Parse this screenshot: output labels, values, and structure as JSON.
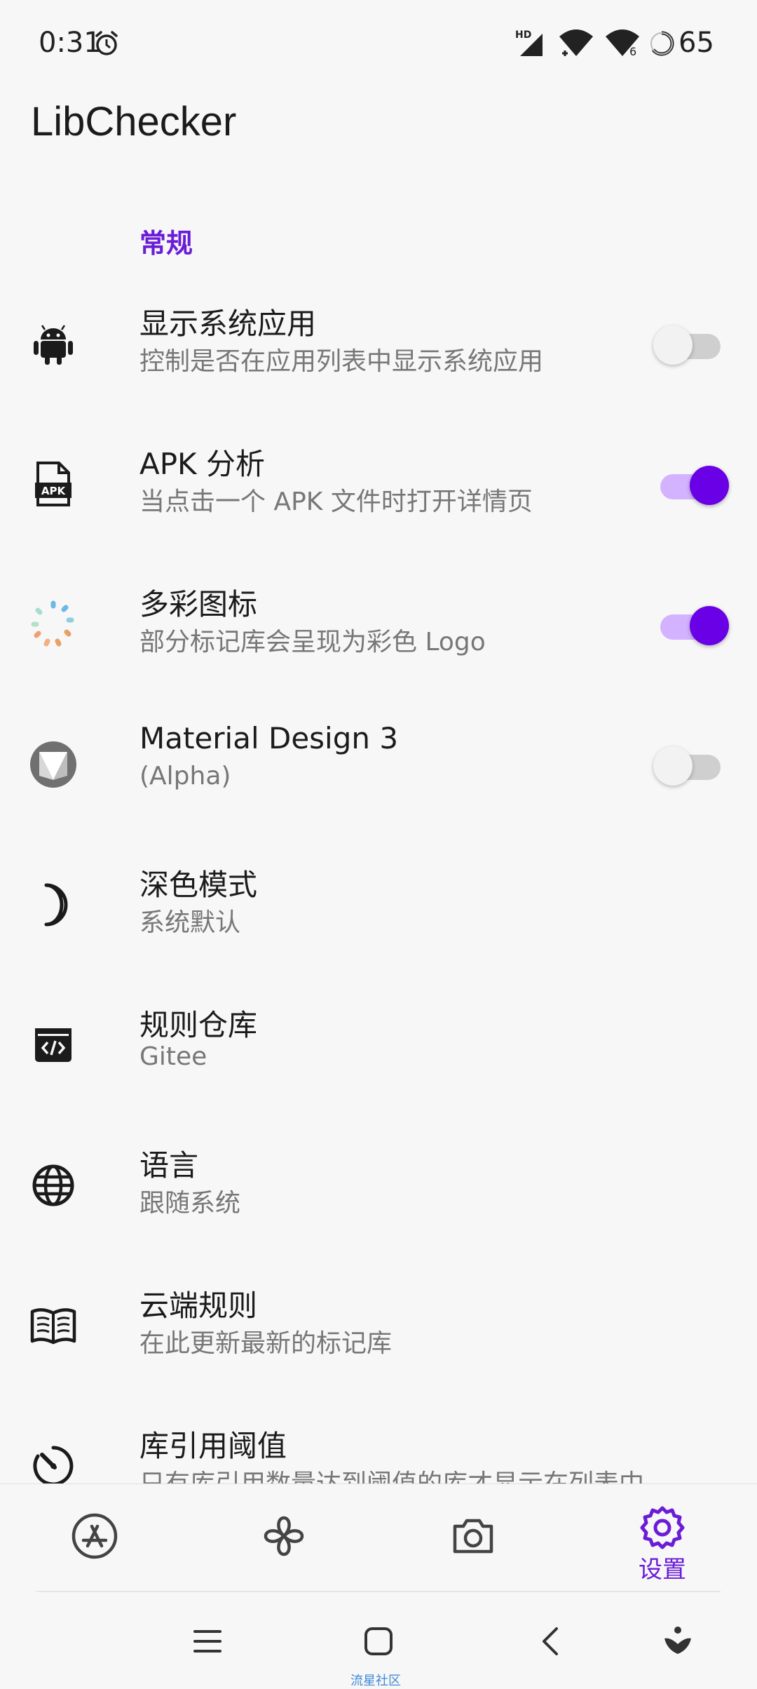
{
  "status_bar": {
    "time": "0:31",
    "network_badge": "HD",
    "wifi_badge": "6",
    "battery": "65",
    "icons": [
      "alarm-icon",
      "cell-signal-icon",
      "wifi-icon",
      "wifi-6-icon",
      "battery-icon"
    ]
  },
  "app": {
    "title": "LibChecker"
  },
  "settings": {
    "section_general": "常规",
    "items": [
      {
        "title": "显示系统应用",
        "subtitle": "控制是否在应用列表中显示系统应用",
        "icon": "android-icon",
        "toggle": "off"
      },
      {
        "title": "APK 分析",
        "subtitle": "当点击一个 APK 文件时打开详情页",
        "icon": "apk-file-icon",
        "toggle": "on"
      },
      {
        "title": "多彩图标",
        "subtitle": "部分标记库会呈现为彩色 Logo",
        "icon": "colorful-dots-icon",
        "toggle": "on"
      },
      {
        "title": "Material Design 3",
        "subtitle": "(Alpha)",
        "icon": "material-design-icon",
        "toggle": "off"
      },
      {
        "title": "深色模式",
        "subtitle": "系统默认",
        "icon": "moon-icon"
      },
      {
        "title": "规则仓库",
        "subtitle": "Gitee",
        "icon": "code-box-icon"
      },
      {
        "title": "语言",
        "subtitle": "跟随系统",
        "icon": "globe-icon"
      },
      {
        "title": "云端规则",
        "subtitle": "在此更新最新的标记库",
        "icon": "book-icon"
      },
      {
        "title": "库引用阈值",
        "subtitle": "只有库引用数量达到阈值的库才显示在列表中",
        "icon": "timer-icon"
      }
    ]
  },
  "bottom_nav": {
    "items": [
      {
        "icon": "app-store-icon",
        "label": ""
      },
      {
        "icon": "statistics-flower-icon",
        "label": ""
      },
      {
        "icon": "camera-icon",
        "label": ""
      },
      {
        "icon": "settings-gear-icon",
        "label": "设置"
      }
    ],
    "active_color": "#6a1cd8"
  },
  "system_nav": {
    "icons": [
      "menu-icon",
      "home-icon",
      "back-icon",
      "assistant-icon"
    ],
    "watermark": "流星社区"
  }
}
